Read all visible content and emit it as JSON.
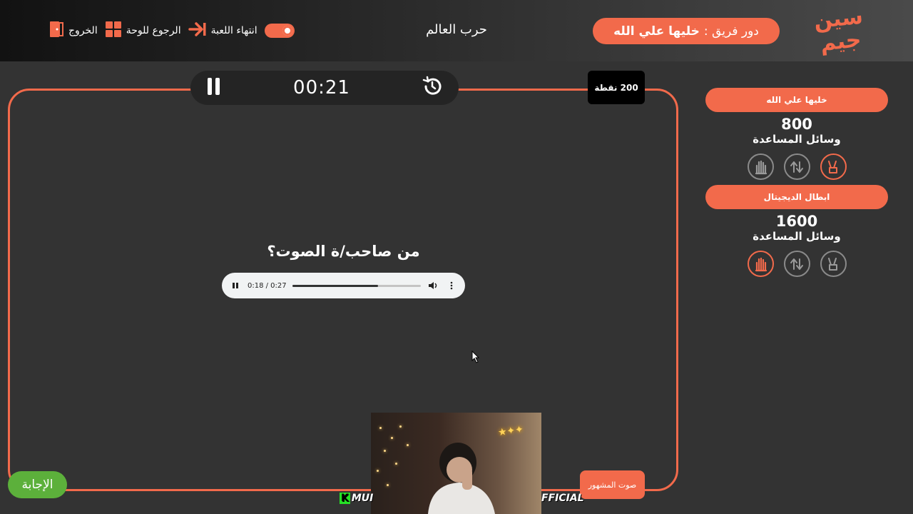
{
  "header": {
    "logo_text": "سين جيم",
    "turn_label": "دور فريق :",
    "turn_team": "خليها علي الله",
    "game_title": "حرب العالم",
    "actions": {
      "end_game": "انتهاء اللعبة",
      "back_to_board": "الرجوع للوحة",
      "exit": "الخروج"
    }
  },
  "question_board": {
    "timer": "00:21",
    "points": "200 نقطة",
    "question": "من صاحب/ة الصوت؟",
    "audio": {
      "time": "0:18 / 0:27",
      "progress": 0.667
    },
    "answer_button": "الإجابة",
    "category": "صوت المشهور"
  },
  "webcam": {
    "overlay_left": "MUI",
    "overlay_left_badge": "K",
    "overlay_right": "FFICIAL"
  },
  "teams": [
    {
      "name": "خليها علي الله",
      "score": "800",
      "helpers_label": "وسائل المساعدة",
      "helpers": [
        {
          "icon": "peace-hand-icon",
          "active": true
        },
        {
          "icon": "swap-arrows-icon",
          "active": false
        },
        {
          "icon": "stop-hand-icon",
          "active": false
        }
      ]
    },
    {
      "name": "ابطال الديجيتال",
      "score": "1600",
      "helpers_label": "وسائل المساعدة",
      "helpers": [
        {
          "icon": "peace-hand-icon",
          "active": false
        },
        {
          "icon": "swap-arrows-icon",
          "active": false
        },
        {
          "icon": "stop-hand-icon",
          "active": true
        }
      ]
    }
  ],
  "colors": {
    "accent": "#f26a4b",
    "answer": "#5cb03b",
    "background": "#333333"
  }
}
